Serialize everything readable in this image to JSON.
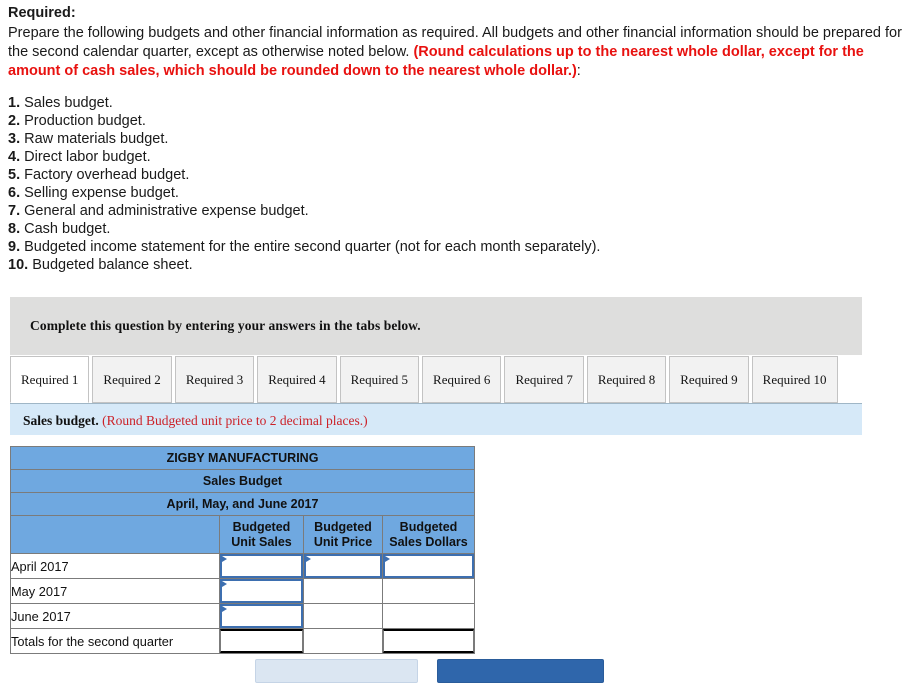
{
  "requirement": {
    "heading": "Required:",
    "paragraph_part1": "Prepare the following budgets and other financial information as required. All budgets and other financial information should be prepared for the second calendar quarter, except as otherwise noted below. ",
    "paragraph_note": "(Round calculations up to the nearest whole dollar, except for the amount of cash sales, which should be rounded down to the nearest whole dollar.)",
    "paragraph_part2": ":",
    "items": [
      {
        "num": "1.",
        "text": "Sales budget."
      },
      {
        "num": "2.",
        "text": "Production budget."
      },
      {
        "num": "3.",
        "text": "Raw materials budget."
      },
      {
        "num": "4.",
        "text": "Direct labor budget."
      },
      {
        "num": "5.",
        "text": "Factory overhead budget."
      },
      {
        "num": "6.",
        "text": "Selling expense budget."
      },
      {
        "num": "7.",
        "text": "General and administrative expense budget."
      },
      {
        "num": "8.",
        "text": "Cash budget."
      },
      {
        "num": "9.",
        "text": "Budgeted income statement for the entire second quarter (not for each month separately)."
      },
      {
        "num": "10.",
        "text": "Budgeted balance sheet."
      }
    ]
  },
  "instruction_panel": {
    "text": "Complete this question by entering your answers in the tabs below."
  },
  "tabs": {
    "active_index": 0,
    "items": [
      {
        "label": "Required 1"
      },
      {
        "label": "Required 2"
      },
      {
        "label": "Required 3"
      },
      {
        "label": "Required 4"
      },
      {
        "label": "Required 5"
      },
      {
        "label": "Required 6"
      },
      {
        "label": "Required 7"
      },
      {
        "label": "Required 8"
      },
      {
        "label": "Required 9"
      },
      {
        "label": "Required 10"
      }
    ]
  },
  "sub_instruction": {
    "title": "Sales budget.",
    "note": "(Round Budgeted unit price to 2 decimal places.)"
  },
  "table": {
    "company": "ZIGBY MANUFACTURING",
    "statement": "Sales Budget",
    "period": "April, May, and June 2017",
    "columns": [
      {
        "line1": "Budgeted",
        "line2": "Unit Sales"
      },
      {
        "line1": "Budgeted",
        "line2": "Unit Price"
      },
      {
        "line1": "Budgeted",
        "line2": "Sales Dollars"
      }
    ],
    "rows": [
      {
        "label": "April 2017",
        "unit_sales": "",
        "unit_price": "",
        "sales_dollars": ""
      },
      {
        "label": "May 2017",
        "unit_sales": "",
        "unit_price": "",
        "sales_dollars": ""
      },
      {
        "label": "June 2017",
        "unit_sales": "",
        "unit_price": "",
        "sales_dollars": ""
      }
    ],
    "totals_row": {
      "label": "Totals for the second quarter",
      "unit_sales": "",
      "unit_price": "",
      "sales_dollars": ""
    }
  },
  "footer_buttons": {
    "previous_label": "",
    "next_label": ""
  },
  "colors": {
    "header_blue": "#6fa8e0",
    "sub_instruction_blue": "#d6e9f8",
    "panel_grey": "#dededd",
    "note_red": "#cc2128",
    "alert_red": "#e8110f",
    "input_focus_blue": "#3d6fb0",
    "button_primary": "#2f66ab",
    "button_secondary": "#dbe6f2"
  }
}
